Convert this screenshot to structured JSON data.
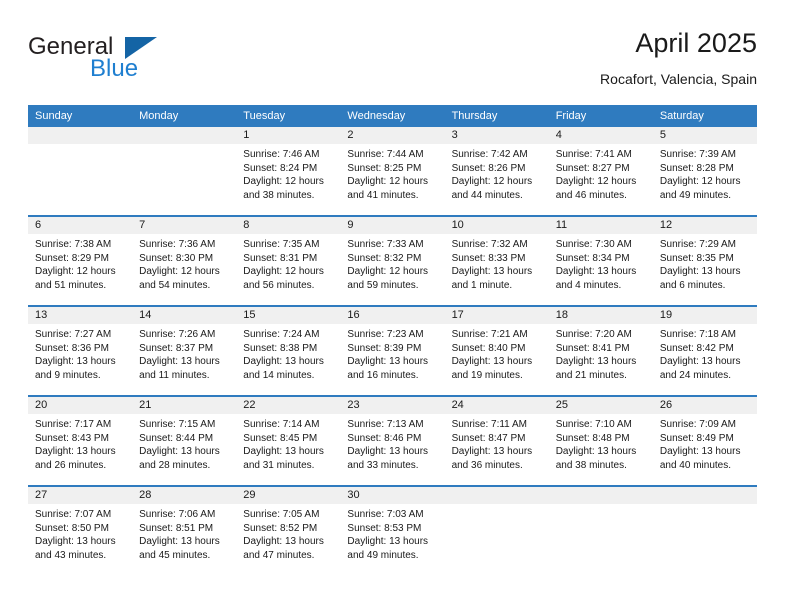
{
  "brand": {
    "name_part1": "General",
    "name_part2": "Blue",
    "flag_icon": "blue-flag-icon",
    "accent_color": "#1f7fd0",
    "flag_color": "#1464a5"
  },
  "header": {
    "title": "April 2025",
    "location": "Rocafort, Valencia, Spain"
  },
  "theme": {
    "header_blue": "#2f7bbf",
    "daynum_band": "#f0f0f0",
    "text": "#1a1a1a"
  },
  "weekday_headers": [
    "Sunday",
    "Monday",
    "Tuesday",
    "Wednesday",
    "Thursday",
    "Friday",
    "Saturday"
  ],
  "weeks": [
    [
      {
        "day": "",
        "sunrise": "",
        "sunset": "",
        "daylight": "",
        "empty": true
      },
      {
        "day": "",
        "sunrise": "",
        "sunset": "",
        "daylight": "",
        "empty": true
      },
      {
        "day": "1",
        "sunrise": "Sunrise: 7:46 AM",
        "sunset": "Sunset: 8:24 PM",
        "daylight": "Daylight: 12 hours and 38 minutes."
      },
      {
        "day": "2",
        "sunrise": "Sunrise: 7:44 AM",
        "sunset": "Sunset: 8:25 PM",
        "daylight": "Daylight: 12 hours and 41 minutes."
      },
      {
        "day": "3",
        "sunrise": "Sunrise: 7:42 AM",
        "sunset": "Sunset: 8:26 PM",
        "daylight": "Daylight: 12 hours and 44 minutes."
      },
      {
        "day": "4",
        "sunrise": "Sunrise: 7:41 AM",
        "sunset": "Sunset: 8:27 PM",
        "daylight": "Daylight: 12 hours and 46 minutes."
      },
      {
        "day": "5",
        "sunrise": "Sunrise: 7:39 AM",
        "sunset": "Sunset: 8:28 PM",
        "daylight": "Daylight: 12 hours and 49 minutes."
      }
    ],
    [
      {
        "day": "6",
        "sunrise": "Sunrise: 7:38 AM",
        "sunset": "Sunset: 8:29 PM",
        "daylight": "Daylight: 12 hours and 51 minutes."
      },
      {
        "day": "7",
        "sunrise": "Sunrise: 7:36 AM",
        "sunset": "Sunset: 8:30 PM",
        "daylight": "Daylight: 12 hours and 54 minutes."
      },
      {
        "day": "8",
        "sunrise": "Sunrise: 7:35 AM",
        "sunset": "Sunset: 8:31 PM",
        "daylight": "Daylight: 12 hours and 56 minutes."
      },
      {
        "day": "9",
        "sunrise": "Sunrise: 7:33 AM",
        "sunset": "Sunset: 8:32 PM",
        "daylight": "Daylight: 12 hours and 59 minutes."
      },
      {
        "day": "10",
        "sunrise": "Sunrise: 7:32 AM",
        "sunset": "Sunset: 8:33 PM",
        "daylight": "Daylight: 13 hours and 1 minute."
      },
      {
        "day": "11",
        "sunrise": "Sunrise: 7:30 AM",
        "sunset": "Sunset: 8:34 PM",
        "daylight": "Daylight: 13 hours and 4 minutes."
      },
      {
        "day": "12",
        "sunrise": "Sunrise: 7:29 AM",
        "sunset": "Sunset: 8:35 PM",
        "daylight": "Daylight: 13 hours and 6 minutes."
      }
    ],
    [
      {
        "day": "13",
        "sunrise": "Sunrise: 7:27 AM",
        "sunset": "Sunset: 8:36 PM",
        "daylight": "Daylight: 13 hours and 9 minutes."
      },
      {
        "day": "14",
        "sunrise": "Sunrise: 7:26 AM",
        "sunset": "Sunset: 8:37 PM",
        "daylight": "Daylight: 13 hours and 11 minutes."
      },
      {
        "day": "15",
        "sunrise": "Sunrise: 7:24 AM",
        "sunset": "Sunset: 8:38 PM",
        "daylight": "Daylight: 13 hours and 14 minutes."
      },
      {
        "day": "16",
        "sunrise": "Sunrise: 7:23 AM",
        "sunset": "Sunset: 8:39 PM",
        "daylight": "Daylight: 13 hours and 16 minutes."
      },
      {
        "day": "17",
        "sunrise": "Sunrise: 7:21 AM",
        "sunset": "Sunset: 8:40 PM",
        "daylight": "Daylight: 13 hours and 19 minutes."
      },
      {
        "day": "18",
        "sunrise": "Sunrise: 7:20 AM",
        "sunset": "Sunset: 8:41 PM",
        "daylight": "Daylight: 13 hours and 21 minutes."
      },
      {
        "day": "19",
        "sunrise": "Sunrise: 7:18 AM",
        "sunset": "Sunset: 8:42 PM",
        "daylight": "Daylight: 13 hours and 24 minutes."
      }
    ],
    [
      {
        "day": "20",
        "sunrise": "Sunrise: 7:17 AM",
        "sunset": "Sunset: 8:43 PM",
        "daylight": "Daylight: 13 hours and 26 minutes."
      },
      {
        "day": "21",
        "sunrise": "Sunrise: 7:15 AM",
        "sunset": "Sunset: 8:44 PM",
        "daylight": "Daylight: 13 hours and 28 minutes."
      },
      {
        "day": "22",
        "sunrise": "Sunrise: 7:14 AM",
        "sunset": "Sunset: 8:45 PM",
        "daylight": "Daylight: 13 hours and 31 minutes."
      },
      {
        "day": "23",
        "sunrise": "Sunrise: 7:13 AM",
        "sunset": "Sunset: 8:46 PM",
        "daylight": "Daylight: 13 hours and 33 minutes."
      },
      {
        "day": "24",
        "sunrise": "Sunrise: 7:11 AM",
        "sunset": "Sunset: 8:47 PM",
        "daylight": "Daylight: 13 hours and 36 minutes."
      },
      {
        "day": "25",
        "sunrise": "Sunrise: 7:10 AM",
        "sunset": "Sunset: 8:48 PM",
        "daylight": "Daylight: 13 hours and 38 minutes."
      },
      {
        "day": "26",
        "sunrise": "Sunrise: 7:09 AM",
        "sunset": "Sunset: 8:49 PM",
        "daylight": "Daylight: 13 hours and 40 minutes."
      }
    ],
    [
      {
        "day": "27",
        "sunrise": "Sunrise: 7:07 AM",
        "sunset": "Sunset: 8:50 PM",
        "daylight": "Daylight: 13 hours and 43 minutes."
      },
      {
        "day": "28",
        "sunrise": "Sunrise: 7:06 AM",
        "sunset": "Sunset: 8:51 PM",
        "daylight": "Daylight: 13 hours and 45 minutes."
      },
      {
        "day": "29",
        "sunrise": "Sunrise: 7:05 AM",
        "sunset": "Sunset: 8:52 PM",
        "daylight": "Daylight: 13 hours and 47 minutes."
      },
      {
        "day": "30",
        "sunrise": "Sunrise: 7:03 AM",
        "sunset": "Sunset: 8:53 PM",
        "daylight": "Daylight: 13 hours and 49 minutes."
      },
      {
        "day": "",
        "sunrise": "",
        "sunset": "",
        "daylight": "",
        "empty": true
      },
      {
        "day": "",
        "sunrise": "",
        "sunset": "",
        "daylight": "",
        "empty": true
      },
      {
        "day": "",
        "sunrise": "",
        "sunset": "",
        "daylight": "",
        "empty": true
      }
    ]
  ]
}
